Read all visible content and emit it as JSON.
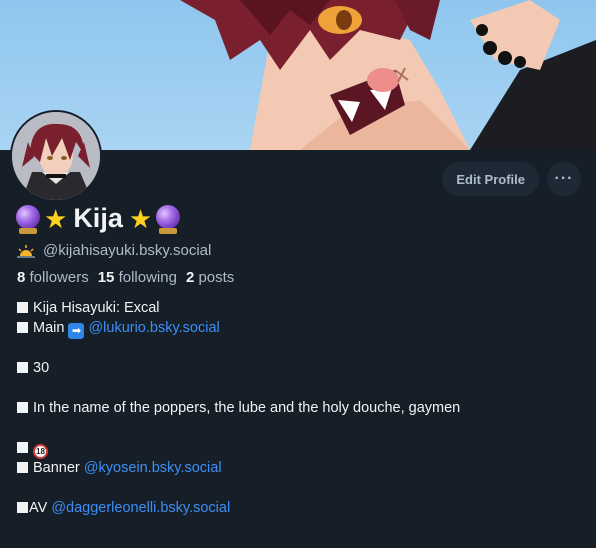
{
  "profile": {
    "display_name": "Kija",
    "handle": "@kijahisayuki.bsky.social",
    "stats": {
      "followers_count": "8",
      "followers_label": "followers",
      "following_count": "15",
      "following_label": "following",
      "posts_count": "2",
      "posts_label": "posts"
    }
  },
  "actions": {
    "edit_label": "Edit Profile",
    "more_label": "···"
  },
  "bio": {
    "line1": "Kija Hisayuki: Excal",
    "line2_prefix": "Main",
    "line2_link": "@lukurio.bsky.social",
    "line3": "30",
    "line4": "In the name of the poppers, the lube and the holy douche, gaymen",
    "line5_emoji": "18",
    "line6_prefix": "Banner",
    "line6_link": "@kyosein.bsky.social",
    "line7_prefix": "AV",
    "line7_link": "@daggerleonelli.bsky.social"
  },
  "icons": {
    "name_left": "crystal-ball-icon",
    "name_star": "star-icon",
    "handle_prefix": "sunrise-icon",
    "arrow": "right-arrow-icon",
    "age": "no-one-under-18-icon"
  },
  "colors": {
    "background": "#161e27",
    "link": "#3d8ef5",
    "muted": "#aebbc9",
    "button_bg": "#1e2936"
  }
}
